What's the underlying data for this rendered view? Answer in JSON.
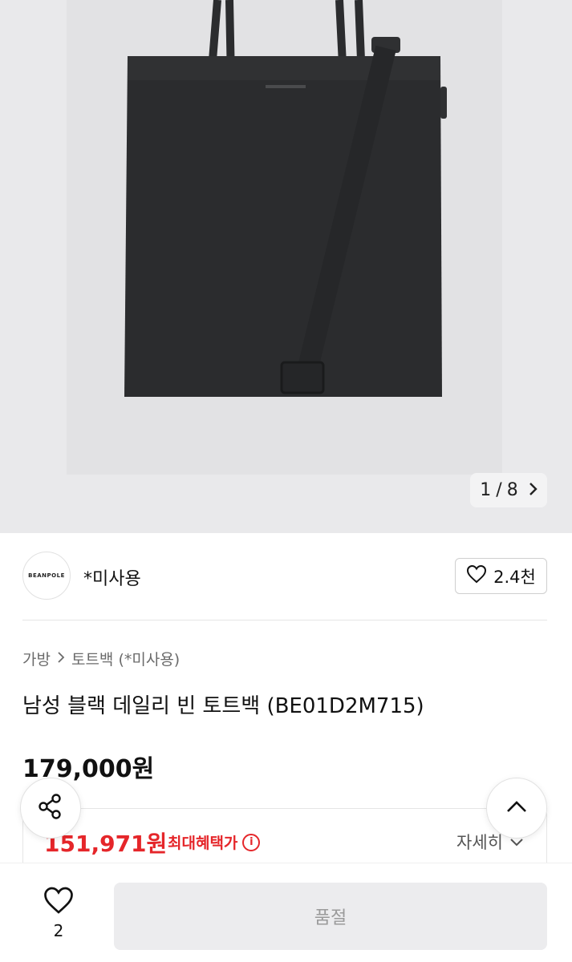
{
  "gallery": {
    "current": "1",
    "separator": "/",
    "total": "8"
  },
  "seller": {
    "logo_text": "BEANPOLE",
    "name": "*미사용",
    "likes": "2.4천"
  },
  "breadcrumb": {
    "category": "가방",
    "subcategory": "토트백 (*미사용)"
  },
  "product": {
    "title": "남성 블랙 데일리 빈 토트백 (BE01D2M715)",
    "price": "179,000원",
    "benefit_price": "151,971원",
    "benefit_label": "최대혜택가",
    "detail_label": "자세히"
  },
  "bottom_bar": {
    "wish_count": "2",
    "soldout_label": "품절"
  },
  "colors": {
    "accent_red": "#e5262a",
    "bag": "#2b2c2e"
  },
  "icons": {
    "pager_next": "chevron-right-icon",
    "like": "heart-outline-icon",
    "share": "share-icon",
    "scroll_top": "chevron-up-icon",
    "info": "info-icon",
    "detail": "chevron-down-icon"
  }
}
